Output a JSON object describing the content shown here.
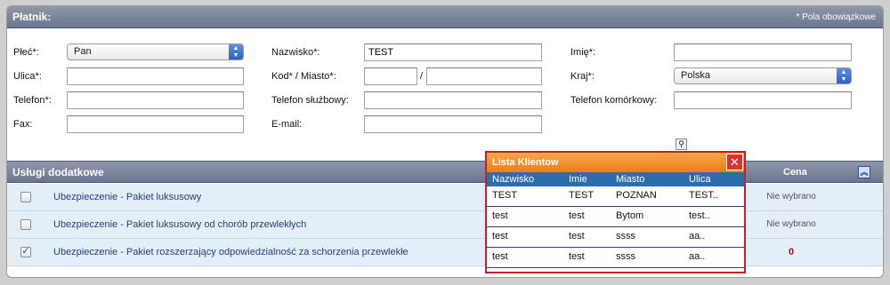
{
  "payer": {
    "title": "Płatnik:",
    "required_note": "* Pola obowiązkowe",
    "fields": {
      "gender_label": "Płeć*:",
      "gender_value": "Pan",
      "surname_label": "Nazwisko*:",
      "surname_value": "TEST",
      "name_label": "Imię*:",
      "name_value": "",
      "street_label": "Ulica*:",
      "street_value": "",
      "postcode_city_label": "Kod* / Miasto*:",
      "postcode_value": "",
      "city_value": "",
      "slash": "/",
      "country_label": "Kraj*:",
      "country_value": "Polska",
      "phone_label": "Telefon*:",
      "phone_value": "",
      "work_phone_label": "Telefon służbowy:",
      "work_phone_value": "",
      "mobile_label": "Telefon komórkowy:",
      "mobile_value": "",
      "fax_label": "Fax:",
      "fax_value": "",
      "email_label": "E-mail:",
      "email_value": ""
    }
  },
  "services": {
    "title": "Usługi dodatkowe",
    "price_header": "Cena",
    "items": [
      {
        "name": "Ubezpieczenie - Pakiet luksusowy",
        "checked": "",
        "price": "Nie wybrano"
      },
      {
        "name": "Ubezpieczenie - Pakiet luksusowy od chorób przewlekłych",
        "checked": "",
        "price": "Nie wybrano"
      },
      {
        "name": "Ubezpieczenie - Pakiet rozszerzający odpowiedzialność za schorzenia przewlekłe",
        "checked": "✓",
        "price": "0"
      }
    ]
  },
  "client_list": {
    "title": "Lista Klientow",
    "close": "✕",
    "headers": [
      "Nazwisko",
      "Imie",
      "Miasto",
      "Ulica"
    ],
    "rows": [
      [
        "TEST",
        "TEST",
        "POZNAN",
        "TEST.."
      ],
      [
        "test",
        "test",
        "Bytom",
        "test.."
      ],
      [
        "test",
        "test",
        "ssss",
        "aa.."
      ],
      [
        "test",
        "test",
        "ssss",
        "aa.."
      ]
    ]
  },
  "colors": {
    "bar": "#6c7590",
    "popup_title": "#e8801b",
    "popup_border": "#c8202b",
    "popup_header": "#2d6cad"
  },
  "icons": {
    "search": "magnifier-icon",
    "collapse": "collapse-up-icon"
  }
}
